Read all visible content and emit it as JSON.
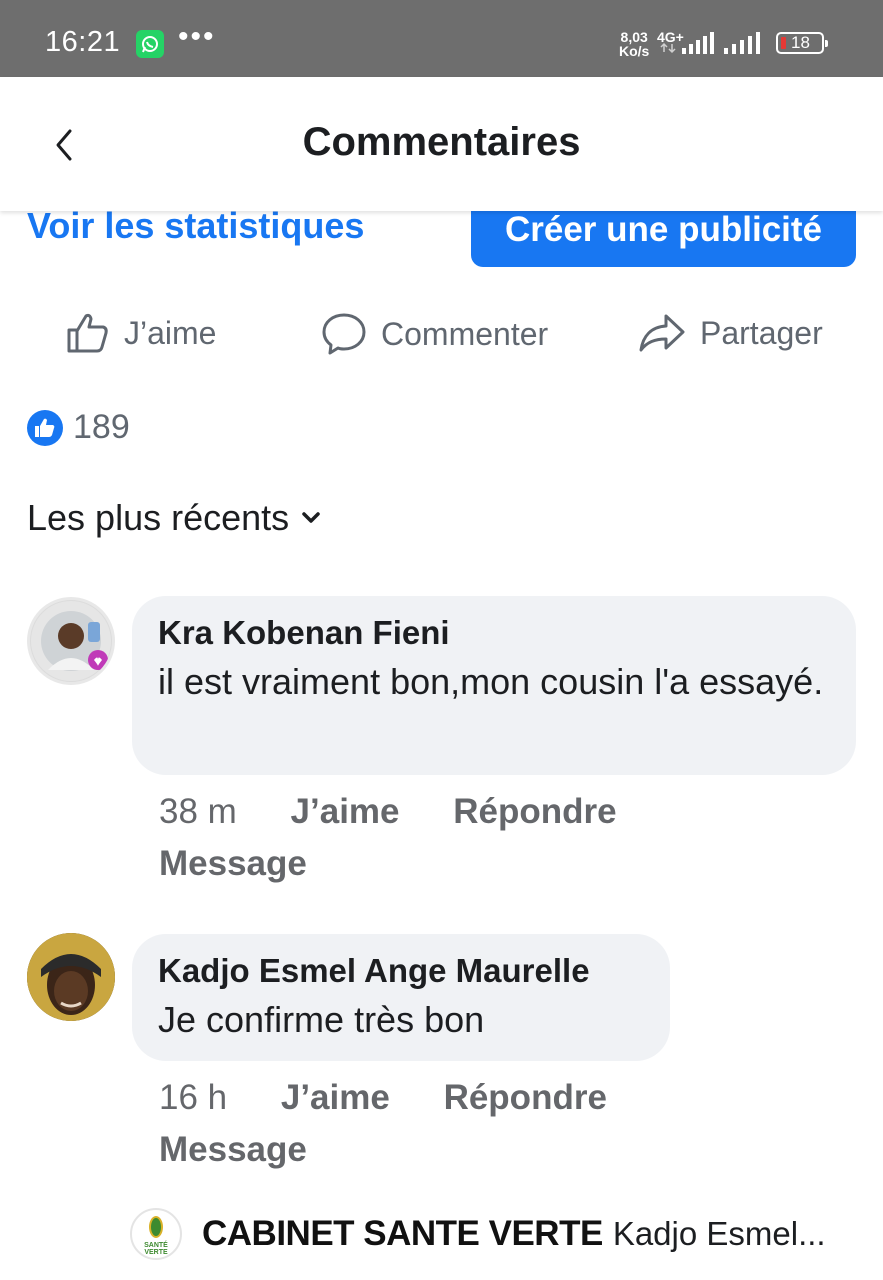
{
  "status_bar": {
    "time": "16:21",
    "more": "•••",
    "speed_value": "8,03",
    "speed_unit": "Ko/s",
    "network": "4G+",
    "battery": "18"
  },
  "header": {
    "title": "Commentaires"
  },
  "post_tools": {
    "stats_link": "Voir les statistiques",
    "create_ad": "Créer une publicité"
  },
  "actions": {
    "like": "J’aime",
    "comment": "Commenter",
    "share": "Partager"
  },
  "reactions": {
    "count": "189"
  },
  "sort": {
    "label": "Les plus récents"
  },
  "comments": [
    {
      "author": "Kra Kobenan Fieni",
      "text": "il est vraiment bon,mon cousin l'a essayé.",
      "time": "38 m",
      "like": "J’aime",
      "reply": "Répondre",
      "message": "Message"
    },
    {
      "author": "Kadjo Esmel Ange Maurelle",
      "text": "Je confirme très bon",
      "time": "16 h",
      "like": "J’aime",
      "reply": "Répondre",
      "message": "Message"
    }
  ],
  "reply_bar": {
    "logo_caption": "SANTÉ VERTE",
    "page_name": "CABINET SANTE VERTE",
    "replying_to": "Kadjo Esmel..."
  },
  "colors": {
    "accent": "#1877f2",
    "status_bar": "#6e6e6e",
    "bubble": "#f0f2f5",
    "meta_text": "#65676b"
  },
  "icons": [
    "back-icon",
    "whatsapp-icon",
    "like-icon",
    "comment-icon",
    "share-icon",
    "chevron-down-icon",
    "signal-icon",
    "battery-icon"
  ]
}
